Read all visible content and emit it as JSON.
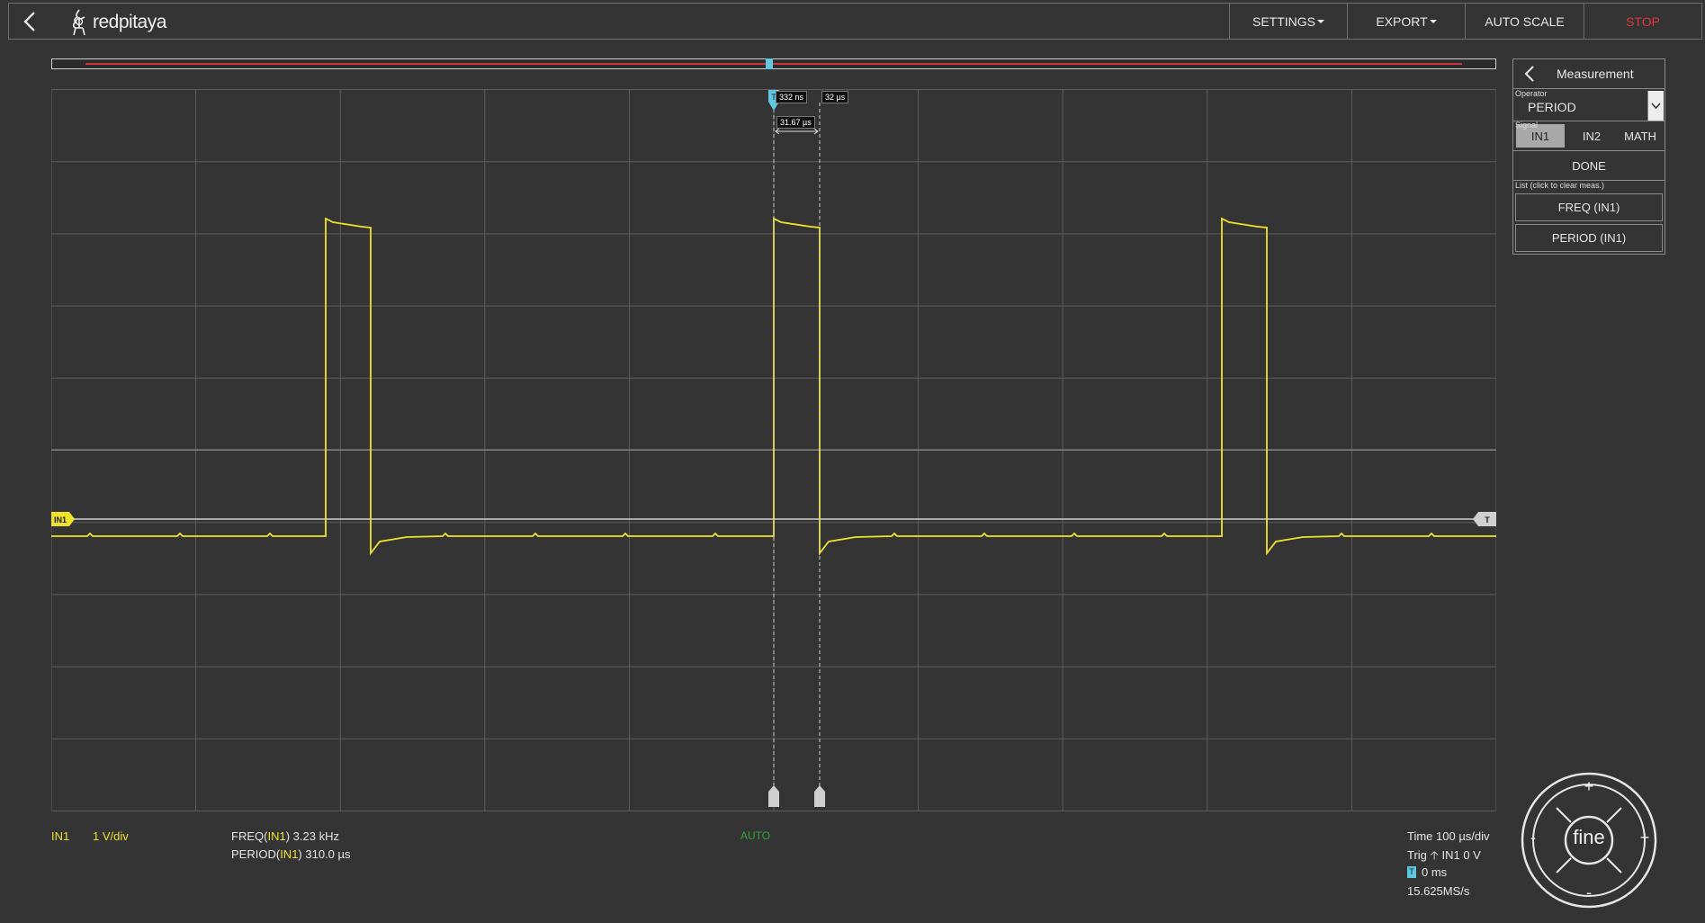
{
  "header": {
    "logo_text": "redpitaya",
    "menu": [
      {
        "label": "SETTINGS",
        "dropdown": true
      },
      {
        "label": "EXPORT",
        "dropdown": true
      },
      {
        "label": "AUTO SCALE",
        "dropdown": false
      },
      {
        "label": "STOP",
        "dropdown": false
      }
    ]
  },
  "scope": {
    "channel_marker": "IN1",
    "trigger_marker": "T",
    "cursor_marker": "T",
    "cursor_left_label": "332 ns",
    "cursor_right_label": "32 µs",
    "cursor_delta_label": "31.67 µs",
    "colors": {
      "background": "#343434",
      "grid": "#5c5c5c",
      "signal": "#f0e22a",
      "cursor": "#5fc8e0",
      "trigger": "#c8c8c8"
    }
  },
  "status": {
    "channel": "IN1",
    "scale": "1 V/div",
    "measurements": [
      {
        "name": "FREQ",
        "channel": "IN1",
        "value": "3.23 kHz"
      },
      {
        "name": "PERIOD",
        "channel": "IN1",
        "value": "310.0 µs"
      }
    ],
    "trigger_mode": "AUTO",
    "time": "Time 100 µs/div",
    "trig": "Trig",
    "trig_source": "IN1 0 V",
    "trig_delay": "0 ms",
    "sample_rate": "15.625MS/s"
  },
  "panel": {
    "title": "Measurement",
    "operator_label": "Operator",
    "operator_value": "PERIOD",
    "signal_label": "Signal",
    "signals": [
      {
        "label": "IN1",
        "active": true
      },
      {
        "label": "IN2",
        "active": false
      },
      {
        "label": "MATH",
        "active": false
      }
    ],
    "done": "DONE",
    "list_label": "List (click to clear meas.)",
    "list": [
      "FREQ (IN1)",
      "PERIOD (IN1)"
    ]
  },
  "navigator": {
    "center": "fine",
    "up": "+",
    "down": "-",
    "left": "-",
    "right": "+"
  }
}
